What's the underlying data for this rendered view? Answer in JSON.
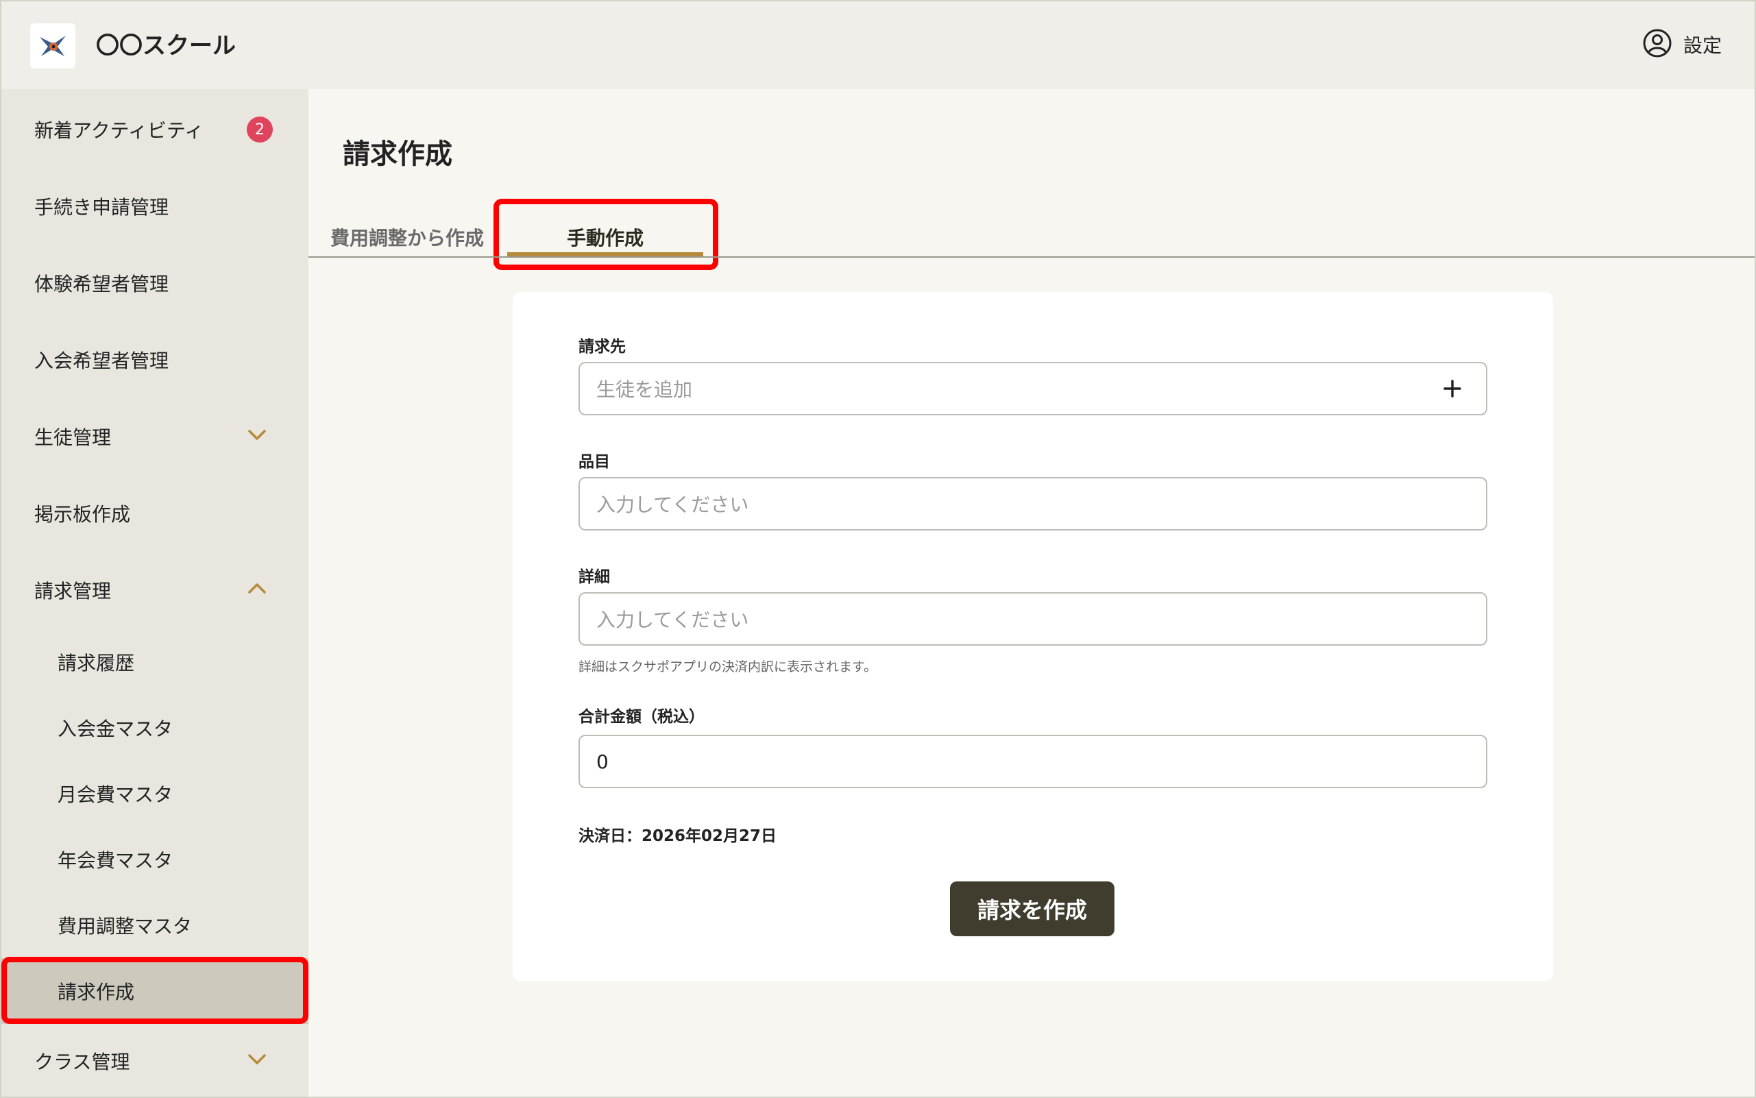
{
  "header": {
    "app_title": "〇〇スクール",
    "settings_label": "設定"
  },
  "sidebar": {
    "items": [
      {
        "label": "新着アクティビティ",
        "badge": "2"
      },
      {
        "label": "手続き申請管理"
      },
      {
        "label": "体験希望者管理"
      },
      {
        "label": "入会希望者管理"
      },
      {
        "label": "生徒管理",
        "icon": "chevron-down-icon"
      },
      {
        "label": "掲示板作成"
      },
      {
        "label": "請求管理",
        "icon": "chevron-up-icon"
      },
      {
        "label": "請求履歴"
      },
      {
        "label": "入会金マスタ"
      },
      {
        "label": "月会費マスタ"
      },
      {
        "label": "年会費マスタ"
      },
      {
        "label": "費用調整マスタ"
      },
      {
        "label": "請求作成",
        "active": true
      },
      {
        "label": "クラス管理",
        "icon": "chevron-down-icon"
      }
    ]
  },
  "main": {
    "title": "請求作成",
    "tabs": [
      {
        "label": "費用調整から作成"
      },
      {
        "label": "手動作成",
        "active": true
      }
    ],
    "form": {
      "billing_to_label": "請求先",
      "billing_to_placeholder": "生徒を追加",
      "item_label": "品目",
      "item_placeholder": "入力してください",
      "detail_label": "詳細",
      "detail_placeholder": "入力してください",
      "detail_help": "詳細はスクサポアプリの決済内訳に表示されます。",
      "total_label": "合計金額（税込）",
      "total_value": "0",
      "payment_date": "決済日：2026年02月27日",
      "submit_label": "請求を作成"
    }
  },
  "colors": {
    "accent": "#b58a3a",
    "badge": "#e0445d",
    "button": "#403c2e",
    "highlight": "#ff0000"
  }
}
